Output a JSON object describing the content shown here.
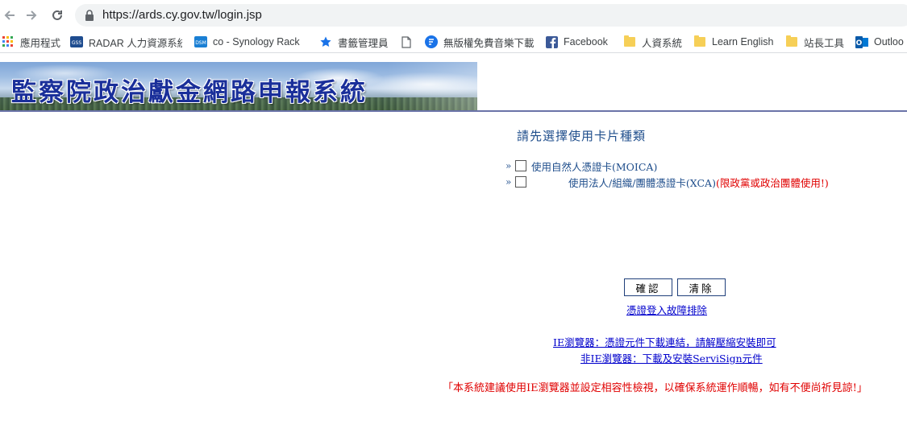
{
  "browser": {
    "url": "https://ards.cy.gov.tw/login.jsp",
    "bookmarks": [
      {
        "label": "應用程式",
        "icon": "apps-grid-icon"
      },
      {
        "label": "RADAR 人力資源系統",
        "icon": "gss-icon"
      },
      {
        "label": "co - Synology Rack",
        "icon": "dsm-icon"
      },
      {
        "label": "書籤管理員",
        "icon": "star-icon"
      },
      {
        "label": "",
        "icon": "page-icon"
      },
      {
        "label": "無版權免費音樂下載",
        "icon": "music-icon"
      },
      {
        "label": "Facebook",
        "icon": "facebook-icon"
      },
      {
        "label": "人資系統",
        "icon": "folder-icon"
      },
      {
        "label": "Learn English",
        "icon": "folder-icon"
      },
      {
        "label": "站長工具",
        "icon": "folder-icon"
      },
      {
        "label": "Outloo",
        "icon": "outlook-icon"
      }
    ]
  },
  "page": {
    "banner_title": "監察院政治獻金網路申報系統",
    "heading": "請先選擇使用卡片種類",
    "options": [
      {
        "arrow": "»",
        "label": "使用自然人憑證卡(MOICA)",
        "warning": ""
      },
      {
        "arrow": "»",
        "label": "使用法人/組織/團體憑證卡(XCA)",
        "warning": "(限政黨或政治團體使用!)"
      }
    ],
    "confirm_label": "確認",
    "clear_label": "清除",
    "troubleshoot_link": "憑證登入故障排除",
    "ie_link": "IE瀏覽器：憑證元件下載連結，請解壓縮安裝即可",
    "non_ie_link": "非IE瀏覽器：下載及安裝ServiSign元件",
    "notice": "「本系統建議使用IE瀏覽器並設定相容性檢視，以確保系統運作順暢，如有不便尚祈見諒!」"
  },
  "colors": {
    "heading_blue": "#1f4e8c",
    "warning_red": "#e00000",
    "link_blue": "#0000cc",
    "banner_title": "#1a2f9a"
  }
}
